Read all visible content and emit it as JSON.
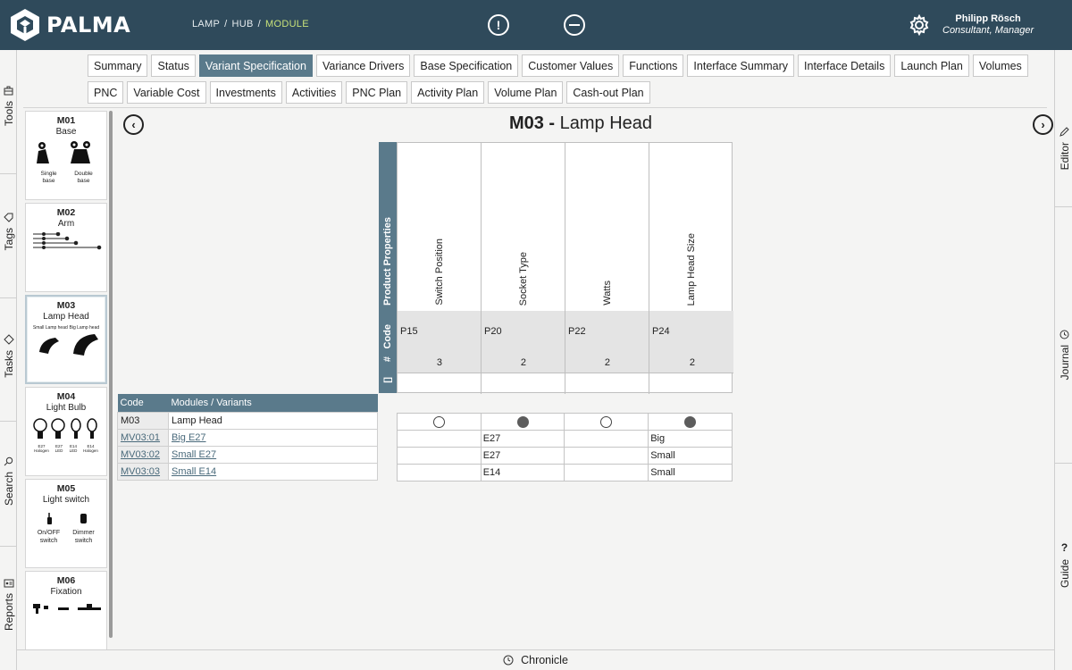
{
  "app": {
    "name": "PALMA"
  },
  "breadcrumb": {
    "items": [
      "LAMP",
      "HUB",
      "MODULE"
    ],
    "separator": "/"
  },
  "header": {
    "alert_icon": "exclamation-circle-icon",
    "minus_icon": "minus-circle-icon",
    "settings_icon": "gear-icon"
  },
  "user": {
    "name": "Philipp Rösch",
    "role": "Consultant, Manager"
  },
  "left_rail": [
    {
      "label": "Tools",
      "icon": "toolbox-icon"
    },
    {
      "label": "Tags",
      "icon": "tag-icon"
    },
    {
      "label": "Tasks",
      "icon": "diamond-icon"
    },
    {
      "label": "Search",
      "icon": "search-icon"
    },
    {
      "label": "Reports",
      "icon": "report-icon"
    }
  ],
  "right_rail": [
    {
      "label": "Editor",
      "icon": "pencil-icon"
    },
    {
      "label": "Journal",
      "icon": "clock-icon"
    },
    {
      "label": "Guide",
      "icon": "question-icon"
    }
  ],
  "tabs": {
    "row1": [
      "Summary",
      "Status",
      "Variant Specification",
      "Variance Drivers",
      "Base Specification",
      "Customer Values",
      "Functions",
      "Interface Summary",
      "Interface Details",
      "Launch Plan",
      "Volumes"
    ],
    "row2": [
      "PNC",
      "Variable Cost",
      "Investments",
      "Activities",
      "PNC Plan",
      "Activity Plan",
      "Volume Plan",
      "Cash-out Plan"
    ],
    "active": "Variant Specification"
  },
  "modules": [
    {
      "code": "M01",
      "name": "Base",
      "captions": [
        "Single base",
        "Double base"
      ]
    },
    {
      "code": "M02",
      "name": "Arm"
    },
    {
      "code": "M03",
      "name": "Lamp Head",
      "captions": [
        "Small Lamp head",
        "Big Lamp head"
      ]
    },
    {
      "code": "M04",
      "name": "Light Bulb",
      "captions": [
        "E27 Halogen",
        "E27 LED",
        "E14 LED",
        "E14 Halogen"
      ]
    },
    {
      "code": "M05",
      "name": "Light switch",
      "captions": [
        "On/OFF switch",
        "Dimmer switch"
      ]
    },
    {
      "code": "M06",
      "name": "Fixation"
    }
  ],
  "page": {
    "code": "M03",
    "dash": "-",
    "title": "Lamp Head"
  },
  "properties": {
    "side_labels": {
      "header": "Product Properties",
      "code": "Code",
      "count": "#",
      "extra": "[]"
    },
    "columns": [
      {
        "name": "Switch Position",
        "code": "P15",
        "count": "3"
      },
      {
        "name": "Socket Type",
        "code": "P20",
        "count": "2"
      },
      {
        "name": "Watts",
        "code": "P22",
        "count": "2"
      },
      {
        "name": "Lamp Head Size",
        "code": "P24",
        "count": "2"
      }
    ]
  },
  "variants": {
    "headers": [
      "Code",
      "Modules / Variants"
    ],
    "module_row": {
      "code": "M03",
      "name": "Lamp Head",
      "flags": [
        "empty",
        "filled",
        "empty",
        "filled"
      ]
    },
    "rows": [
      {
        "code": "MV03:01",
        "name": "Big E27",
        "values": [
          "",
          "E27",
          "",
          "Big"
        ]
      },
      {
        "code": "MV03:02",
        "name": "Small E27",
        "values": [
          "",
          "E27",
          "",
          "Small"
        ]
      },
      {
        "code": "MV03:03",
        "name": "Small E14",
        "values": [
          "",
          "E14",
          "",
          "Small"
        ]
      }
    ]
  },
  "footer": {
    "label": "Chronicle",
    "icon": "clock-icon"
  }
}
